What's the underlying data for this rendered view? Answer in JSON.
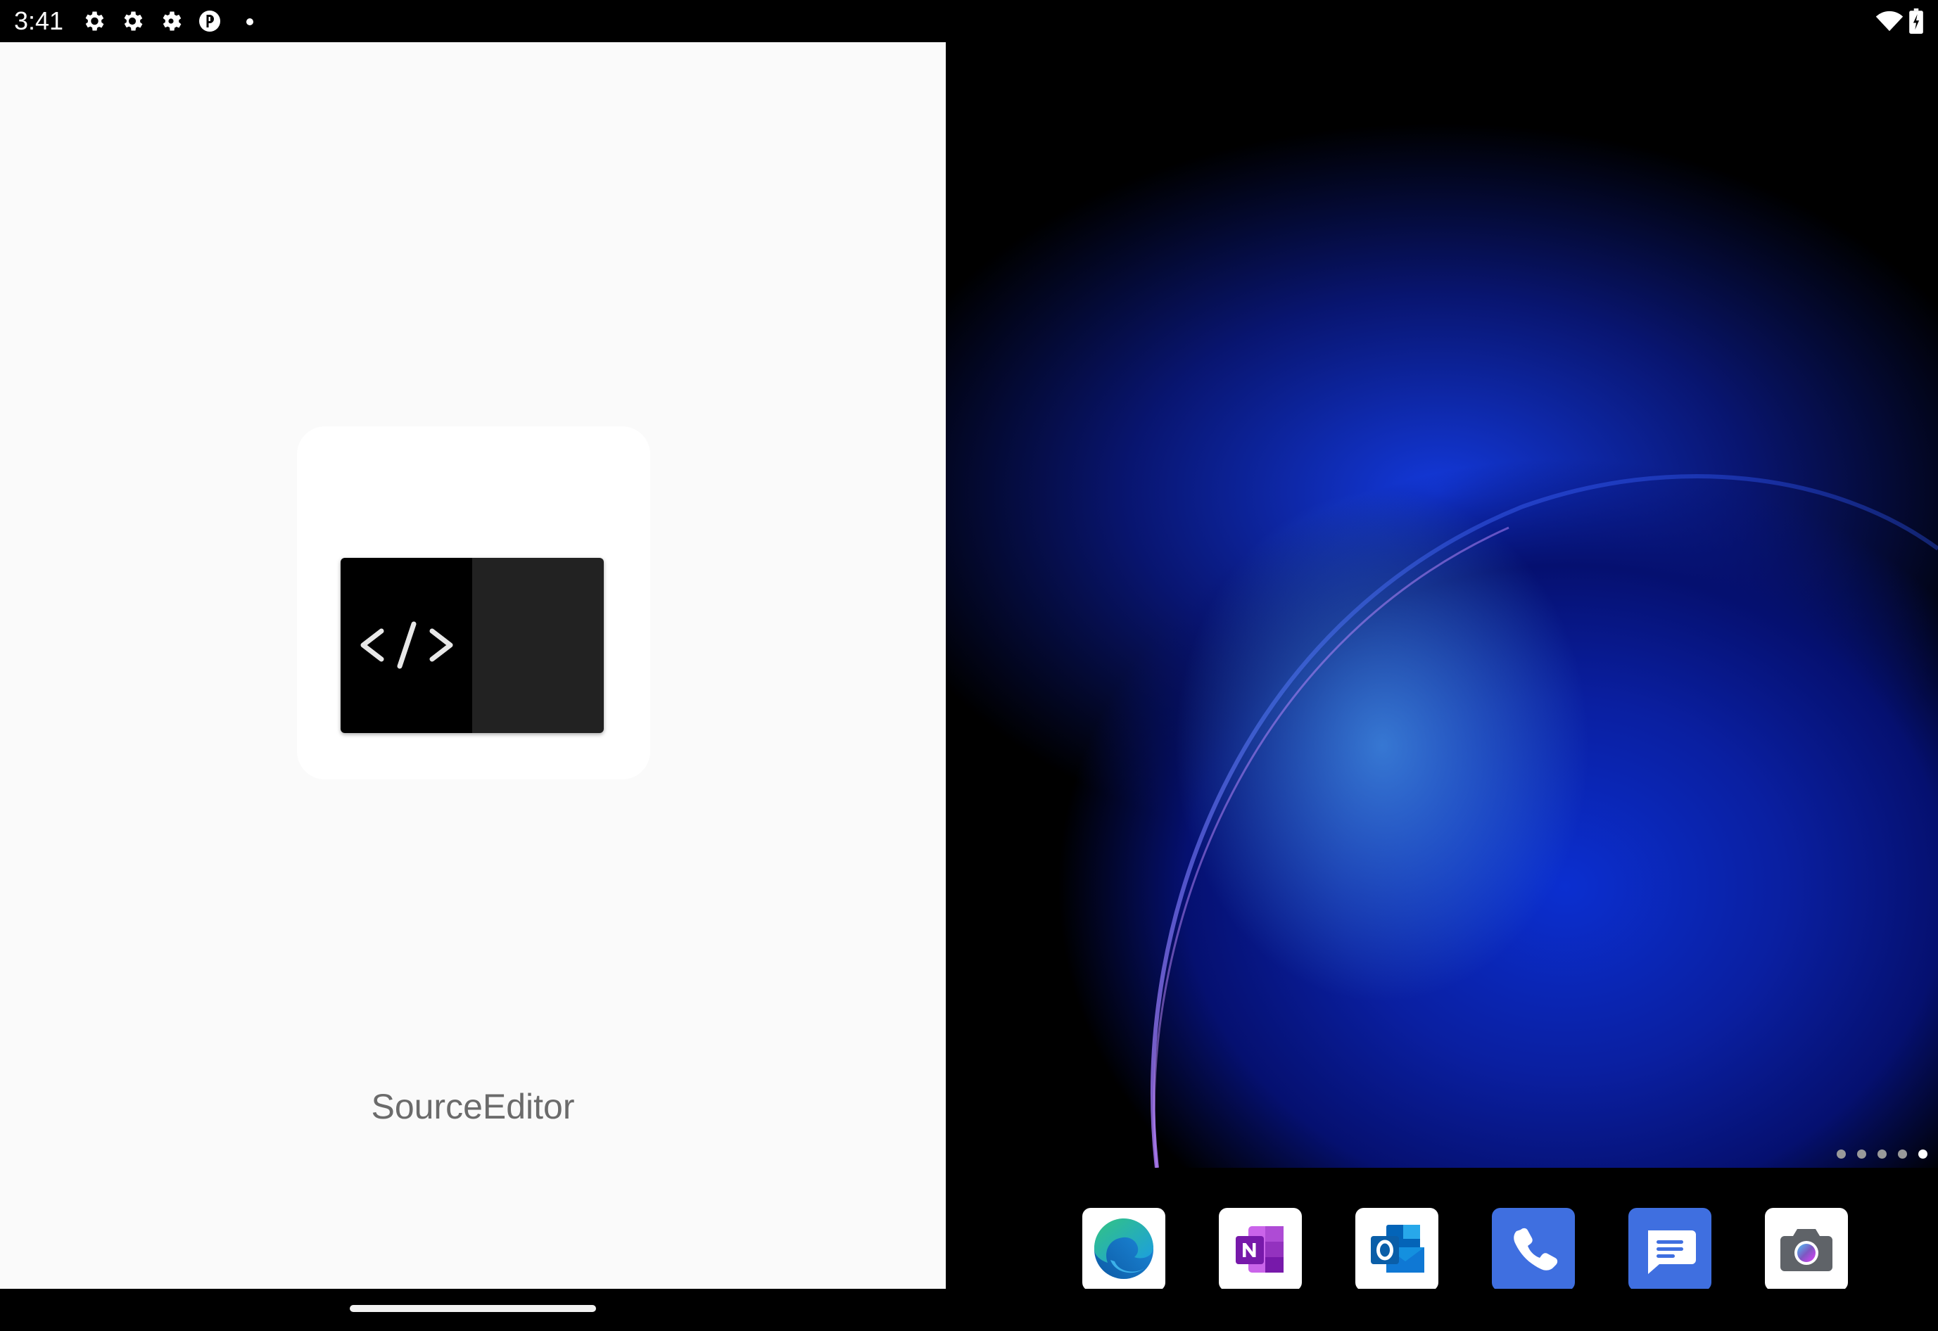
{
  "status_bar": {
    "time": "3:41",
    "left_icons": [
      "settings-gear-icon",
      "settings-gear-icon",
      "settings-cog-icon",
      "app-notification-icon",
      "notification-dot-icon"
    ],
    "right_icons": [
      "wifi-icon",
      "battery-icon"
    ]
  },
  "splash": {
    "app_icon": "code-editor-icon",
    "app_name": "SourceEditor"
  },
  "home": {
    "page_indicator": {
      "pages": 5,
      "current": 5
    },
    "dock_apps": [
      {
        "name": "Microsoft Edge",
        "icon": "edge-icon"
      },
      {
        "name": "OneNote",
        "icon": "onenote-icon"
      },
      {
        "name": "Outlook",
        "icon": "outlook-icon"
      },
      {
        "name": "Phone",
        "icon": "phone-icon"
      },
      {
        "name": "Messages",
        "icon": "messages-icon"
      },
      {
        "name": "Camera",
        "icon": "camera-icon"
      }
    ]
  },
  "colors": {
    "accent_blue": "#3f6fe0",
    "splash_background": "#fafafa",
    "app_name_text": "#6b6b6b"
  }
}
